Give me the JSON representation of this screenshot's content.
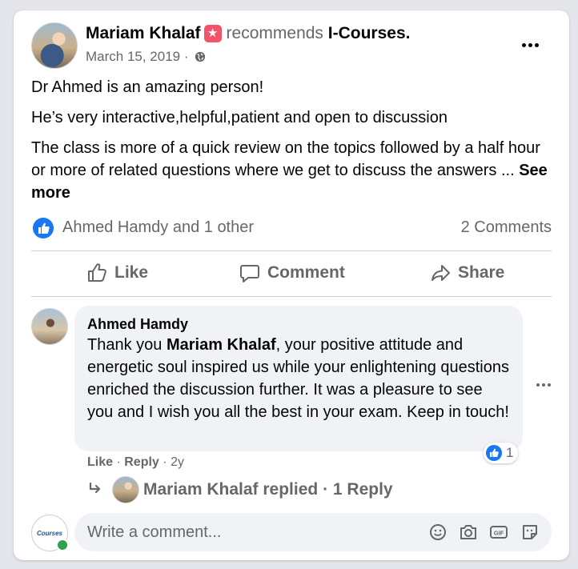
{
  "post": {
    "author": "Mariam Khalaf",
    "recommends_text": "recommends",
    "page_name": "I-Courses.",
    "date": "March 15, 2019 ·",
    "body": [
      "Dr Ahmed is an amazing person!",
      "He’s very interactive,helpful,patient and open to discussion",
      "The class is more of a quick review on the topics followed by a half hour or more of related questions where we get to discuss the answers ..."
    ],
    "see_more": "See more",
    "reactors": "Ahmed Hamdy and 1 other",
    "comments_count": "2 Comments"
  },
  "actions": {
    "like": "Like",
    "comment": "Comment",
    "share": "Share"
  },
  "comment": {
    "author": "Ahmed Hamdy",
    "text_before": "Thank you ",
    "mention": "Mariam Khalaf",
    "text_after": ", your positive attitude and energetic soul inspired us while your enlightening questions enriched the discussion further. It was a pleasure to see you and I wish you all the best in your exam. Keep in touch!",
    "reaction_count": "1",
    "like": "Like",
    "reply": "Reply",
    "age": "2y",
    "sep": "·"
  },
  "replies": {
    "text": "Mariam Khalaf replied · 1 Reply"
  },
  "composer": {
    "placeholder": "Write a comment...",
    "page_avatar_text": "Courses"
  },
  "icons": [
    "globe-icon",
    "more-icon",
    "like-icon",
    "comment-icon",
    "share-icon",
    "reply-arrow-icon",
    "emoji-icon",
    "camera-icon",
    "gif-icon",
    "sticker-icon"
  ],
  "colors": {
    "accent": "#1877f2",
    "text": "#050505",
    "secondary": "#65676b",
    "badge": "#f35369",
    "online": "#31a24c"
  }
}
